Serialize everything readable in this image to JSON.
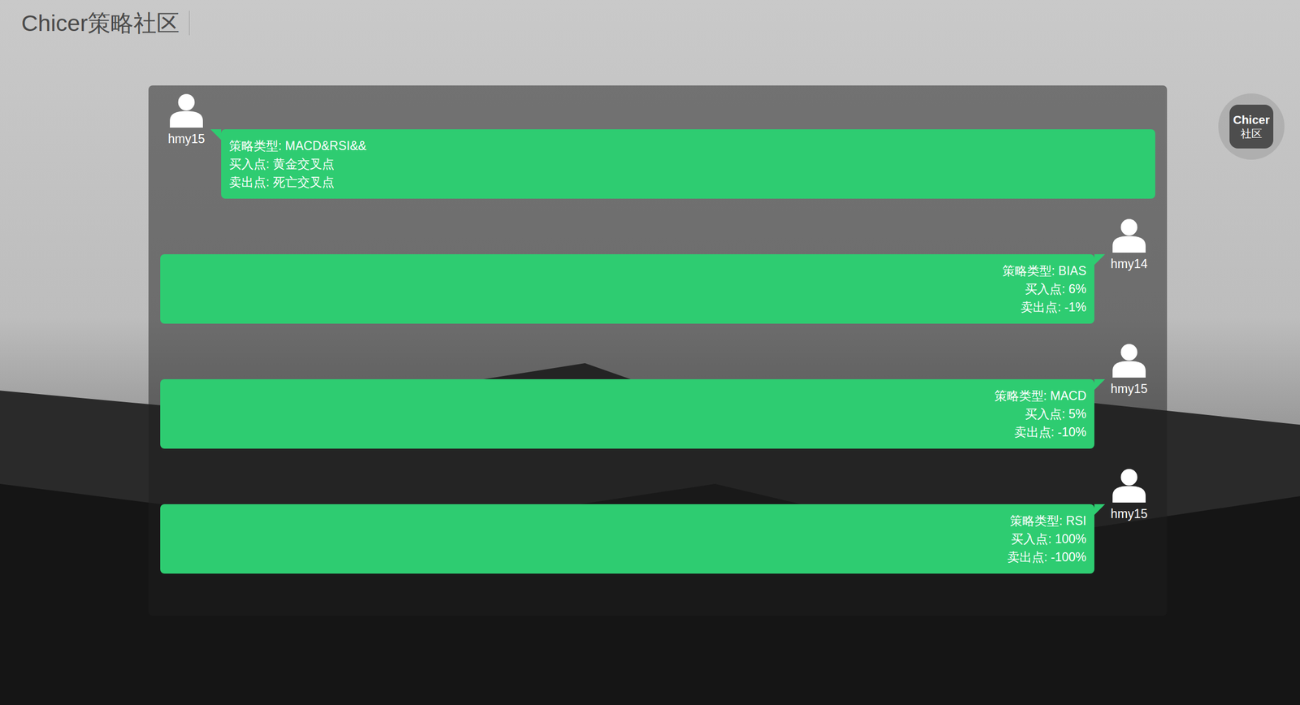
{
  "header": {
    "title": "Chicer策略社区"
  },
  "messages": [
    {
      "kind": "left",
      "user": "hmy15",
      "lines": [
        "策略类型: MACD&RSI&&",
        "买入点: 黄金交叉点",
        "卖出点: 死亡交叉点"
      ]
    },
    {
      "kind": "right",
      "user": "hmy14",
      "lines": [
        "策略类型: BIAS",
        "买入点: 6%",
        "卖出点: -1%"
      ]
    },
    {
      "kind": "right",
      "user": "hmy15",
      "lines": [
        "策略类型: MACD",
        "买入点: 5%",
        "卖出点: -10%"
      ]
    },
    {
      "kind": "right",
      "user": "hmy15",
      "lines": [
        "策略类型: RSI",
        "买入点: 100%",
        "卖出点: -100%"
      ]
    }
  ],
  "float_button": {
    "lines": [
      "Chicer",
      "社区"
    ]
  }
}
